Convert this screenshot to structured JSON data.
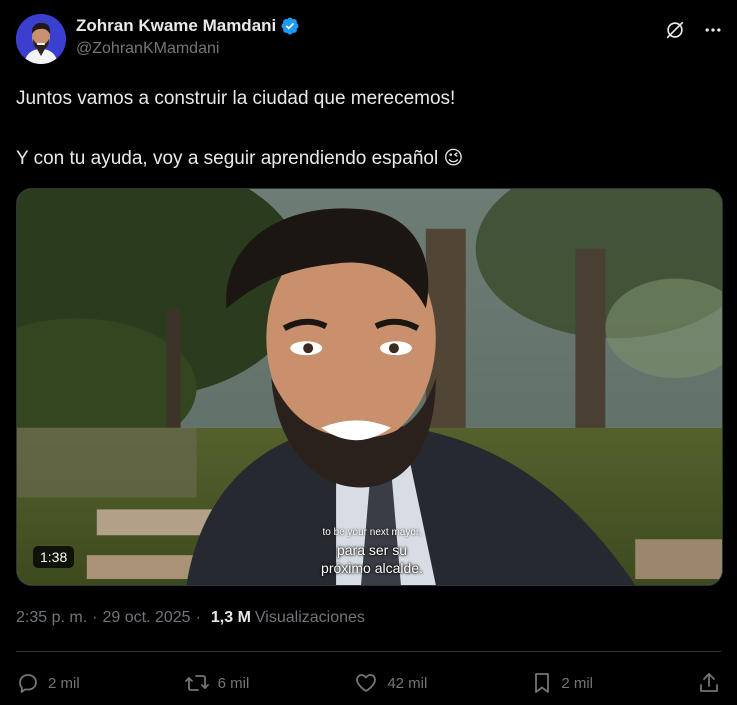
{
  "author": {
    "display_name": "Zohran Kwame Mamdani",
    "handle": "@ZohranKMamdani",
    "verified": true,
    "verified_color": "#1d9bf0"
  },
  "header_icons": [
    "grok-icon",
    "more-icon"
  ],
  "tweet": {
    "line1": "Juntos vamos a construir la ciudad que merecemos!",
    "line2": "Y con tu ayuda, voy a seguir aprendiendo español",
    "emoji": "😉"
  },
  "media": {
    "duration": "1:38",
    "subtitle_en": "to be your next mayor,",
    "subtitle_es_line1": "para ser su",
    "subtitle_es_line2": "próximo alcalde."
  },
  "meta": {
    "time": "2:35 p. m.",
    "separator": "·",
    "date": "29 oct. 2025",
    "views_count": "1,3 M",
    "views_label": "Visualizaciones"
  },
  "actions": {
    "replies": "2 mil",
    "reposts": "6 mil",
    "likes": "42 mil",
    "bookmarks": "2 mil"
  },
  "colors": {
    "background": "#000000",
    "text": "#e7e9ea",
    "muted": "#71767b",
    "border": "#2f3336",
    "accent": "#1d9bf0"
  }
}
